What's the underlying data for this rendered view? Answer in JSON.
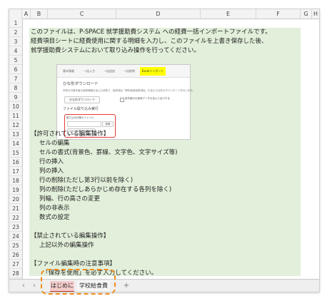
{
  "column_headers": [
    "A",
    "B",
    "C",
    "D",
    "E",
    "F",
    "G",
    "H"
  ],
  "row_numbers": [
    "1",
    "2",
    "3",
    "4",
    "5",
    "6",
    "7",
    "8",
    "9",
    "10",
    "11",
    "12",
    "13",
    "14",
    "15",
    "16",
    "17",
    "18",
    "19",
    "20",
    "21",
    "22",
    "23",
    "24",
    "25",
    "26",
    "27",
    "28",
    "29"
  ],
  "lines": [
    {
      "row": "2",
      "text": "このファイルは、P-SPACE 就学援助費システム への経費一括インポートファイルです。"
    },
    {
      "row": "3",
      "text": "経費項目シートに経費使用に関する明細を入力し、このファイルを上書き保存した後、"
    },
    {
      "row": "4",
      "text": "就学援助費システムにおいて取り込み操作を行ってください。"
    },
    {
      "row": "13",
      "text": "【許可されている編集操作】"
    },
    {
      "row": "14",
      "text": "セルの編集",
      "indent": true
    },
    {
      "row": "15",
      "text": "セルの書式(背景色、罫線、文字色、文字サイズ等)",
      "indent": true
    },
    {
      "row": "16",
      "text": "行の挿入",
      "indent": true
    },
    {
      "row": "17",
      "text": "列の挿入",
      "indent": true
    },
    {
      "row": "18",
      "text": "行の削除(ただし第3行以前を除く)",
      "indent": true
    },
    {
      "row": "19",
      "text": "列の削除(ただしあらかじめ存在する各列を除く)",
      "indent": true
    },
    {
      "row": "20",
      "text": "列幅、行の高さの変更",
      "indent": true
    },
    {
      "row": "21",
      "text": "列の非表示",
      "indent": true
    },
    {
      "row": "22",
      "text": "数式の設定",
      "indent": true
    },
    {
      "row": "24",
      "text": "【禁止されている編集操作】"
    },
    {
      "row": "25",
      "text": "上記以外の編集操作",
      "indent": true
    },
    {
      "row": "27",
      "text": "【ファイル編集時の注意事項】"
    },
    {
      "row": "28",
      "text": "・「保存を使用」を必ず入力してください。",
      "indent": true
    }
  ],
  "panel": {
    "tabs": [
      "基本情報",
      "一括入力",
      "一括追加",
      "一括削除",
      "Excelインポート"
    ],
    "download_title": "ひな形ダウンロード",
    "download_desc": "学校の対象年度の経費情報を含んだ状態で、経費項目「単年度用経費項目」を含むひな形のダウンロードを行います。",
    "download_button": "ひな形ダウンロード",
    "checkbox_label": "前年度分の経費データも含んで出力する",
    "import_title": "ファイル取り込み実行",
    "file_label": "取り込み対象のファイル",
    "browse_button": "参照",
    "import_button": "ファイル取り込みの実行"
  },
  "sheet_tabs": {
    "tab1": "はじめに",
    "tab2": "学校給食費",
    "add_tab": "+",
    "nav_prev": "‹",
    "nav_next": "›"
  },
  "colors": {
    "green_fill": "#e2efda",
    "active_tab_fill": "#f4cccc",
    "highlight": "#f08c1a",
    "red_box": "#e53935"
  }
}
